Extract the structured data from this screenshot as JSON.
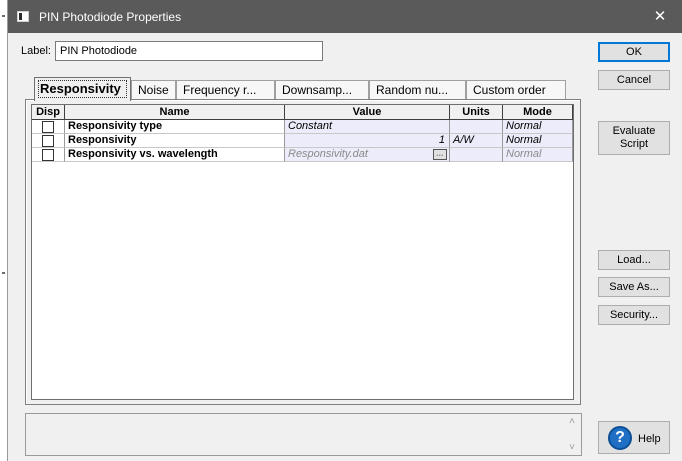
{
  "window": {
    "title": "PIN Photodiode Properties",
    "close_glyph": "✕",
    "icon": "window-icon"
  },
  "label_field": {
    "label": "Label:",
    "value": "PIN Photodiode"
  },
  "buttons": {
    "ok": "OK",
    "cancel": "Cancel",
    "evaluate_line1": "Evaluate",
    "evaluate_line2": "Script",
    "load": "Load...",
    "save_as": "Save As...",
    "security": "Security...",
    "help": "Help"
  },
  "tabs": [
    {
      "label": "Responsivity",
      "active": true
    },
    {
      "label": "Noise"
    },
    {
      "label": "Frequency r..."
    },
    {
      "label": "Downsamp..."
    },
    {
      "label": "Random nu..."
    },
    {
      "label": "Custom order"
    }
  ],
  "table": {
    "headers": {
      "disp": "Disp",
      "name": "Name",
      "value": "Value",
      "units": "Units",
      "mode": "Mode"
    },
    "rows": [
      {
        "name": "Responsivity type",
        "value": "Constant",
        "units": "",
        "mode": "Normal",
        "disp_checked": false
      },
      {
        "name": "Responsivity",
        "value": "1",
        "units": "A/W",
        "mode": "Normal",
        "disp_checked": false
      },
      {
        "name": "Responsivity vs. wavelength",
        "value": "Responsivity.dat",
        "units": "",
        "mode": "Normal",
        "disp_checked": false,
        "has_browse": true,
        "browse_label": "..."
      }
    ]
  },
  "description_box": {
    "scroll_up": "˄",
    "scroll_down": "˅"
  },
  "colors": {
    "titlebar": "#5a5a5a",
    "dialog_bg": "#f0f0f0",
    "value_cell_bg": "#ececfa",
    "help_icon": "#1f6fc5"
  }
}
